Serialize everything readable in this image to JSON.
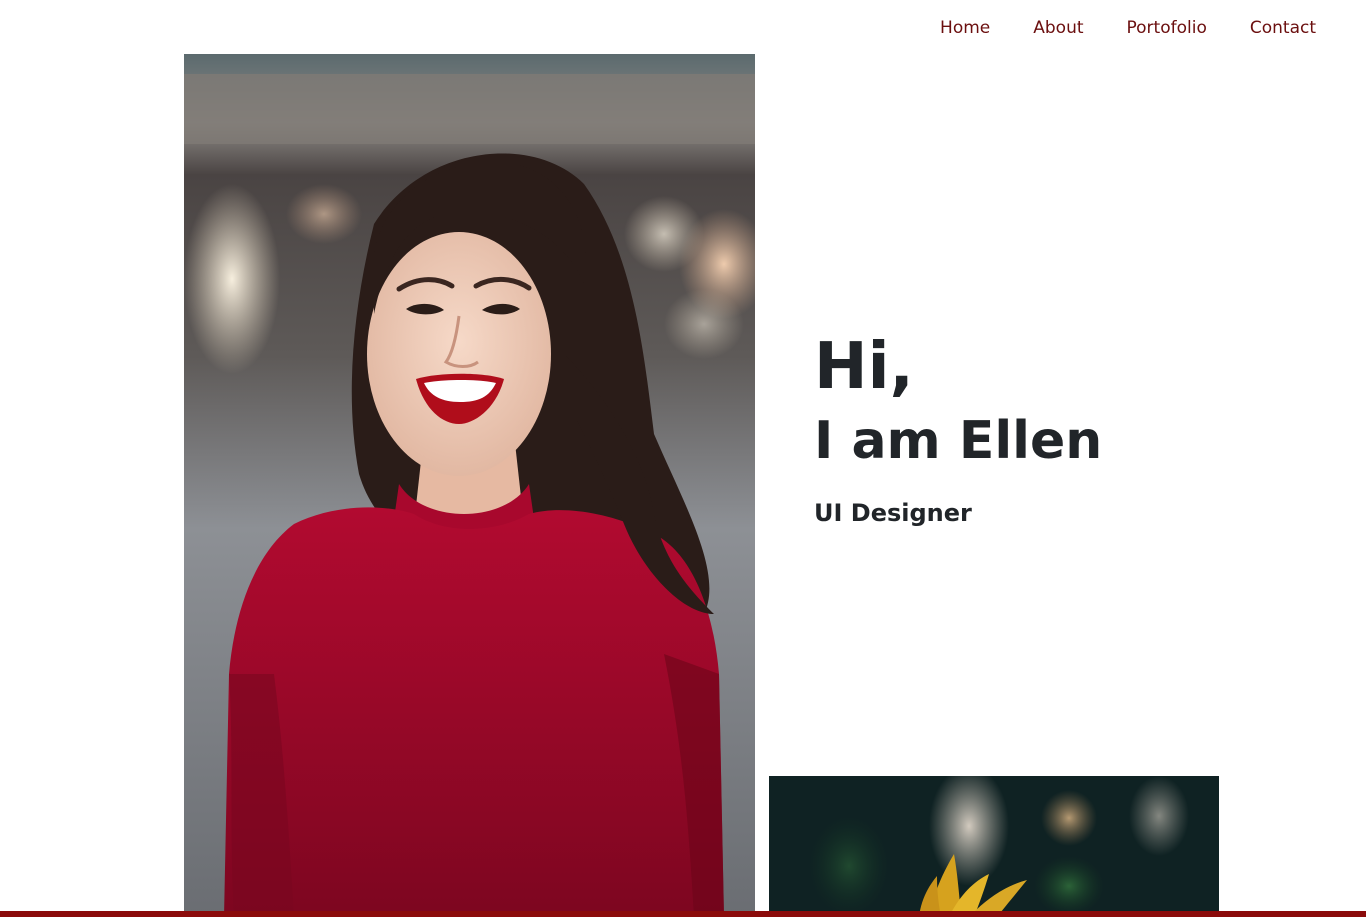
{
  "nav": {
    "items": [
      {
        "label": "Home"
      },
      {
        "label": "About"
      },
      {
        "label": "Portofolio"
      },
      {
        "label": "Contact"
      }
    ]
  },
  "hero": {
    "greeting": "Hi,",
    "name_line": "I am Ellen",
    "role": "UI Designer"
  },
  "colors": {
    "nav_link": "#6b0f0f",
    "heading": "#212529",
    "accent_bar": "#8b0b0b",
    "dress_red": "#a3062a"
  },
  "images": {
    "portrait": "portrait-photo",
    "flower": "flower-photo"
  }
}
